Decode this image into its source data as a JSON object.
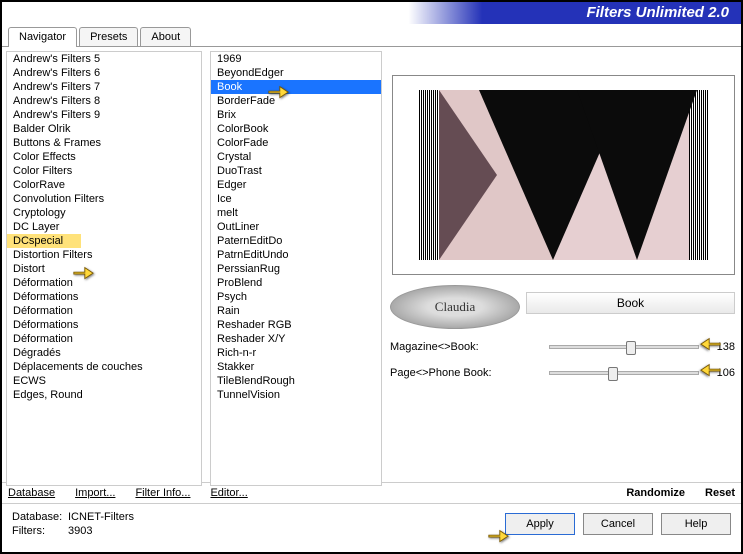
{
  "app_title": "Filters Unlimited 2.0",
  "tabs": [
    "Navigator",
    "Presets",
    "About"
  ],
  "active_tab": 0,
  "category_list": [
    "Andrew's Filters 5",
    "Andrew's Filters 6",
    "Andrew's Filters 7",
    "Andrew's Filters 8",
    "Andrew's Filters 9",
    "Balder Olrik",
    "Buttons & Frames",
    "Color Effects",
    "Color Filters",
    "ColorRave",
    "Convolution Filters",
    "Cryptology",
    "DC Layer",
    "DCspecial",
    "Distortion Filters",
    "Distort",
    "Déformation",
    "Déformations",
    "Déformation",
    "Déformations",
    "Déformation",
    "Dégradés",
    "Déplacements de couches",
    "ECWS",
    "Edges, Round"
  ],
  "category_selected_index": 13,
  "filter_list": [
    "1969",
    "BeyondEdger",
    "Book",
    "BorderFade",
    "Brix",
    "ColorBook",
    "ColorFade",
    "Crystal",
    "DuoTrast",
    "Edger",
    "Ice",
    "melt",
    "OutLiner",
    "PaternEditDo",
    "PatrnEditUndo",
    "PerssianRug",
    "ProBlend",
    "Psych",
    "Rain",
    "Reshader RGB",
    "Reshader X/Y",
    "Rich-n-r",
    "Stakker",
    "TileBlendRough",
    "TunnelVision"
  ],
  "filter_selected_index": 2,
  "current_filter_name": "Book",
  "watermark_text": "Claudia",
  "params": [
    {
      "label": "Magazine<>Book:",
      "value": 138,
      "max": 255
    },
    {
      "label": "Page<>Phone Book:",
      "value": 106,
      "max": 255
    }
  ],
  "bottom_links": {
    "database": "Database",
    "import": "Import...",
    "filter_info": "Filter Info...",
    "editor": "Editor...",
    "randomize": "Randomize",
    "reset": "Reset"
  },
  "status": {
    "db_label": "Database:",
    "db_value": "ICNET-Filters",
    "filters_label": "Filters:",
    "filters_value": "3903"
  },
  "buttons": {
    "apply": "Apply",
    "cancel": "Cancel",
    "help": "Help"
  }
}
